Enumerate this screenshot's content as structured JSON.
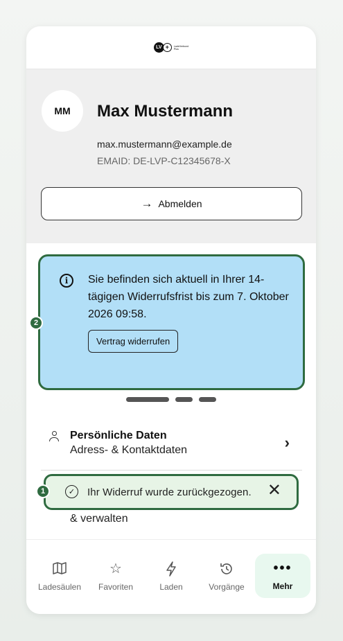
{
  "header": {
    "logo_mark": "LV",
    "logo_line1": "LadeVerbund",
    "logo_line2": "Plus"
  },
  "profile": {
    "initials": "MM",
    "name": "Max Mustermann",
    "email": "max.mustermann@example.de",
    "emaid": "EMAID: DE-LVP-C12345678-X",
    "logout_label": "Abmelden"
  },
  "info_card": {
    "text": "Sie befinden sich aktuell in Ihrer 14-tägigen Widerrufsfrist bis zum 7. Oktober 2026 09:58.",
    "button_label": "Vertrag widerrufen"
  },
  "annotations": {
    "badge_1": "1",
    "badge_2": "2"
  },
  "carousel": {
    "pages": 3,
    "active_index": 0
  },
  "menu": {
    "personal_title": "Persönliche Daten",
    "personal_sub": "Adress- & Kontaktdaten",
    "partial_row": "& verwalten"
  },
  "toast": {
    "text": "Ihr Widerruf wurde zurückgezogen."
  },
  "nav": {
    "items": [
      {
        "label": "Ladesäulen",
        "icon": "map-icon"
      },
      {
        "label": "Favoriten",
        "icon": "star-icon"
      },
      {
        "label": "Laden",
        "icon": "bolt-icon"
      },
      {
        "label": "Vorgänge",
        "icon": "history-icon"
      },
      {
        "label": "Mehr",
        "icon": "more-icon"
      }
    ],
    "active_index": 4
  },
  "colors": {
    "accent_green": "#2f6b40",
    "info_blue": "#b2dff7",
    "toast_bg": "#e7f4e6",
    "active_nav_bg": "#e8f8ef"
  }
}
